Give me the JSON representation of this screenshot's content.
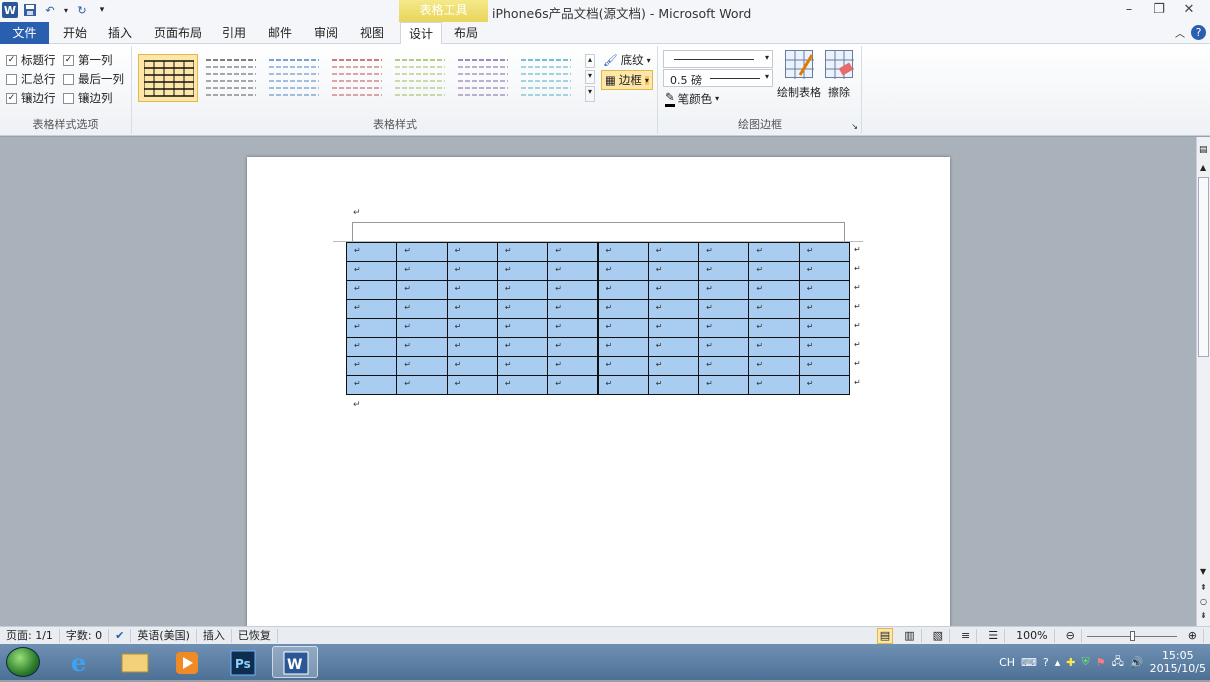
{
  "title_bar": {
    "contextual_header": "表格工具",
    "window_title": "iPhone6s产品文档(源文档) - Microsoft Word"
  },
  "tabs": {
    "file": "文件",
    "items": [
      "开始",
      "插入",
      "页面布局",
      "引用",
      "邮件",
      "审阅",
      "视图",
      "设计",
      "布局"
    ],
    "active_index": 7
  },
  "ribbon": {
    "options_group": {
      "label": "表格样式选项",
      "checks": [
        {
          "label": "标题行",
          "checked": true
        },
        {
          "label": "第一列",
          "checked": true
        },
        {
          "label": "汇总行",
          "checked": false
        },
        {
          "label": "最后一列",
          "checked": false
        },
        {
          "label": "镶边行",
          "checked": true
        },
        {
          "label": "镶边列",
          "checked": false
        }
      ]
    },
    "styles_group": {
      "label": "表格样式",
      "shading_label": "底纹",
      "border_label": "边框",
      "style_colors": [
        "#111111",
        "#555555",
        "#4f81bd",
        "#c0504d",
        "#9bbb59",
        "#8064a2",
        "#4bacc6"
      ]
    },
    "borders_group": {
      "label": "绘图边框",
      "weight_label": "0.5 磅",
      "pen_color_label": "笔颜色",
      "draw_table_label": "绘制表格",
      "eraser_label": "擦除"
    }
  },
  "document": {
    "table": {
      "rows": 8,
      "cols": 10,
      "cell_marker": "↵",
      "fill_color": "#a9cdf0"
    },
    "paragraph_mark": "↵"
  },
  "status_bar": {
    "page": "页面: 1/1",
    "words": "字数: 0",
    "language": "英语(美国)",
    "mode": "插入",
    "recovered": "已恢复",
    "zoom": "100%"
  },
  "taskbar": {
    "ime": "CH",
    "time": "15:05",
    "date": "2015/10/5"
  }
}
